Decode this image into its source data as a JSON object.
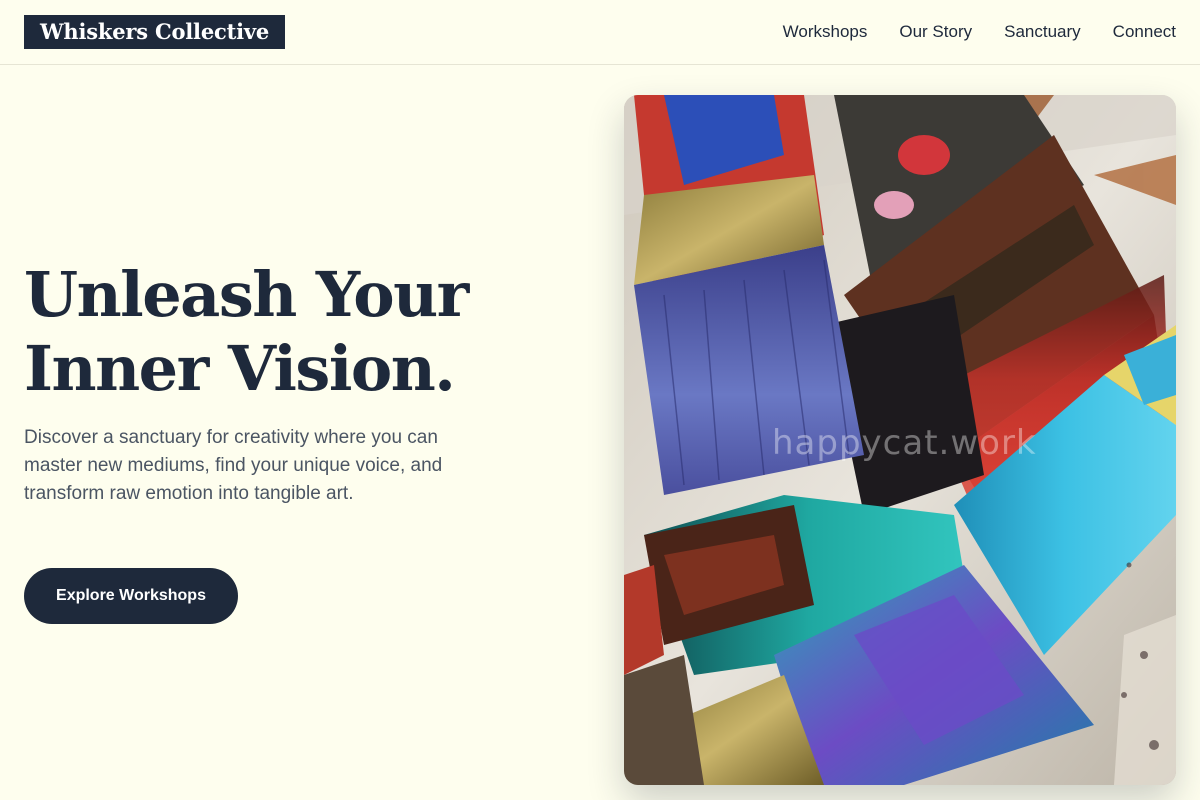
{
  "header": {
    "logo": "Whiskers Collective",
    "nav": [
      "Workshops",
      "Our Story",
      "Sanctuary",
      "Connect"
    ]
  },
  "hero": {
    "title_line1": "Unleash Your",
    "title_line2": "Inner Vision.",
    "description": "Discover a sanctuary for creativity where you can master new mediums, find your unique voice, and transform raw emotion into tangible art.",
    "cta_label": "Explore Workshops"
  },
  "image": {
    "subject": "paint-brushes-photo",
    "watermark": "happycat.work"
  },
  "colors": {
    "background": "#fefeee",
    "primary": "#1e293b",
    "body_text": "#4b5563"
  }
}
